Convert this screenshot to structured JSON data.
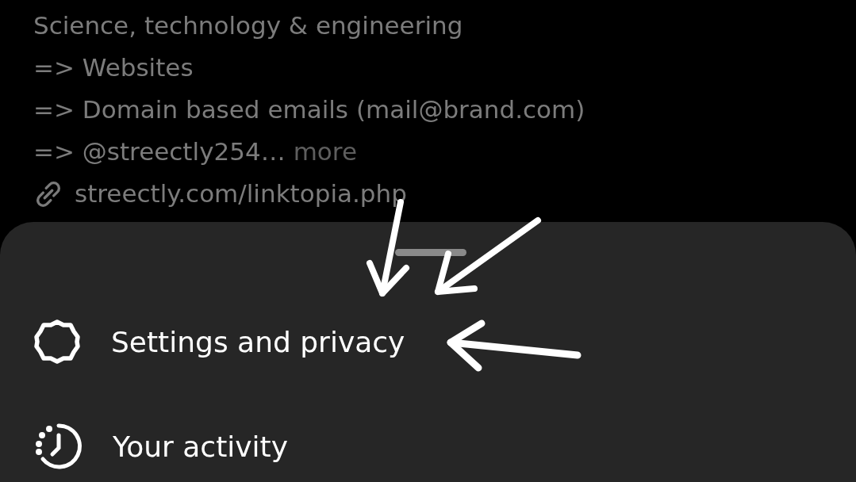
{
  "bio": {
    "lines": [
      "Science, technology & engineering",
      "=> Websites",
      "=> Domain based emails (mail@brand.com)"
    ],
    "truncated_line": {
      "text": "=> @streectly254…",
      "more": "more"
    },
    "link": "streectly.com/linktopia.php"
  },
  "menu": {
    "items": [
      {
        "kind": "settings",
        "label": "Settings and privacy"
      },
      {
        "kind": "activity",
        "label": "Your activity"
      }
    ]
  }
}
